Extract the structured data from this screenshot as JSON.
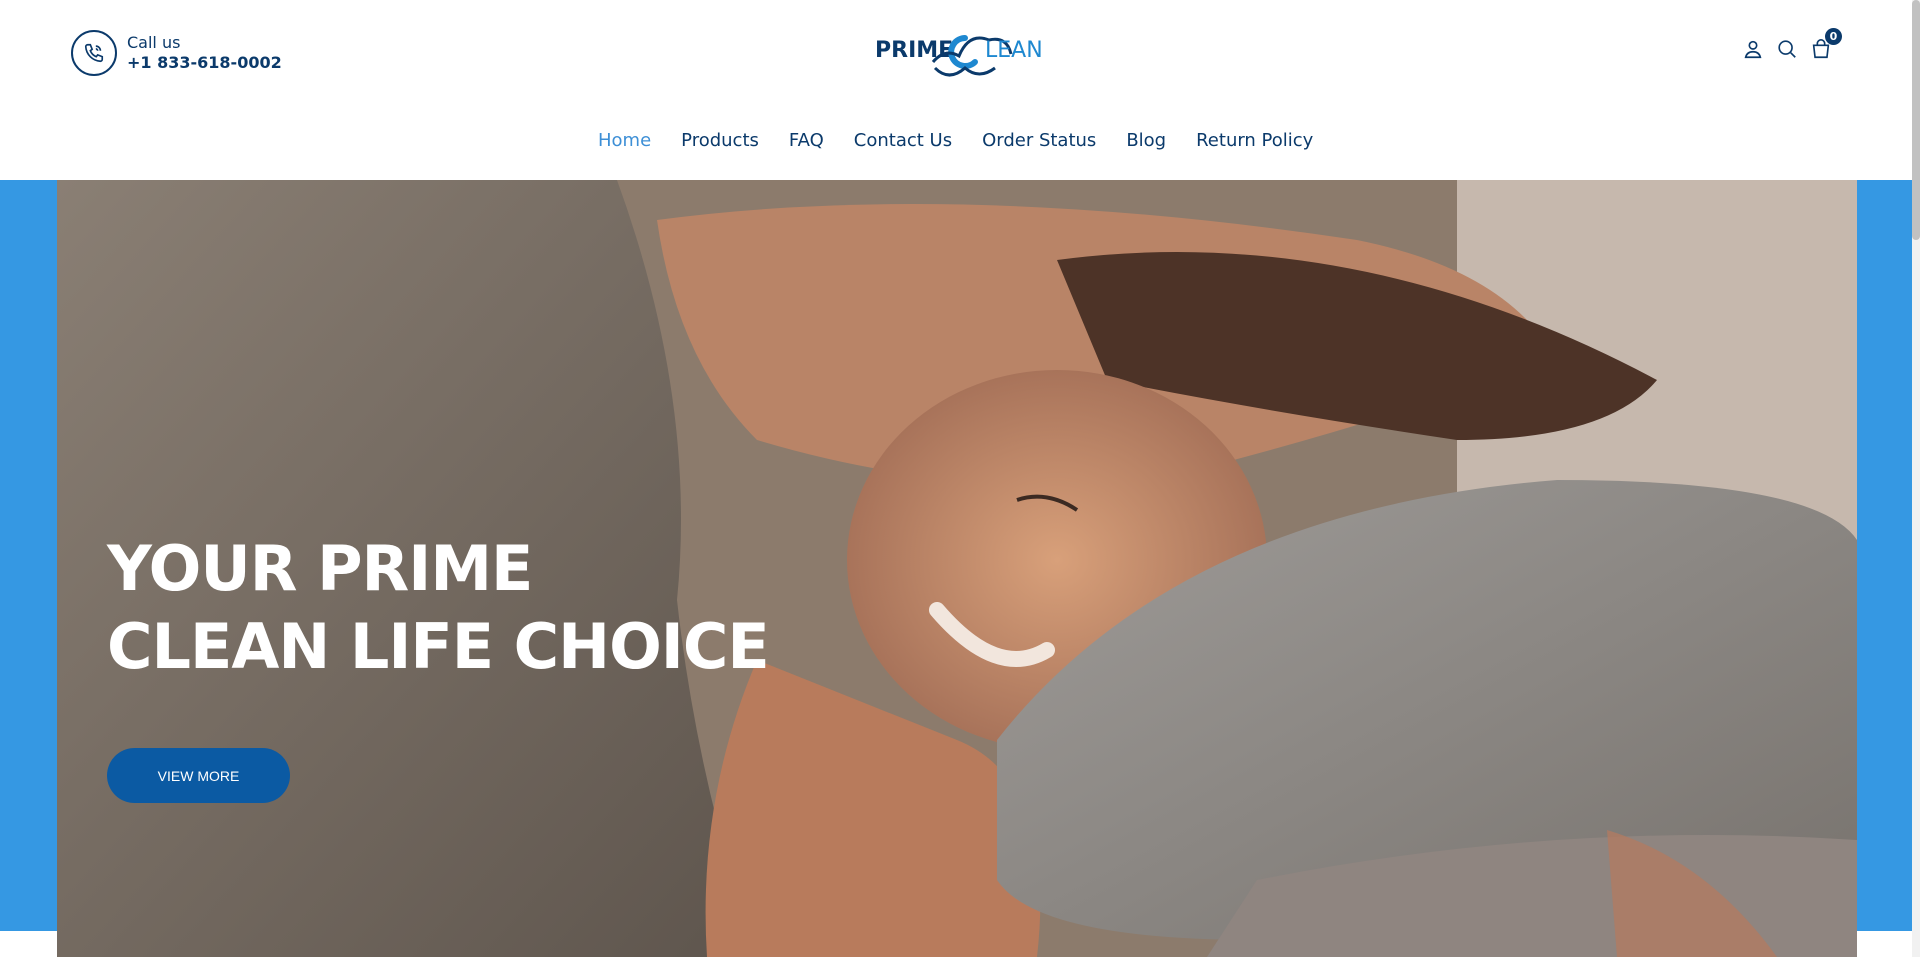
{
  "header": {
    "call_label": "Call us",
    "phone": "+1 833-618-0002",
    "logo_text_left": "PRIME",
    "logo_text_right": "LEAN",
    "cart_count": "0"
  },
  "nav": {
    "items": [
      {
        "label": "Home",
        "active": true
      },
      {
        "label": "Products"
      },
      {
        "label": "FAQ"
      },
      {
        "label": "Contact Us"
      },
      {
        "label": "Order Status"
      },
      {
        "label": "Blog"
      },
      {
        "label": "Return Policy"
      }
    ]
  },
  "hero": {
    "title_line1": "YOUR PRIME",
    "title_line2": "CLEAN LIFE CHOICE",
    "button_label": "VIEW MORE"
  },
  "colors": {
    "brand_dark": "#0b3a6b",
    "brand_blue": "#3598e3",
    "nav_active": "#3d8fd6",
    "button": "#0b5aa3"
  },
  "icons": [
    "phone-icon",
    "user-icon",
    "search-icon",
    "cart-icon"
  ]
}
